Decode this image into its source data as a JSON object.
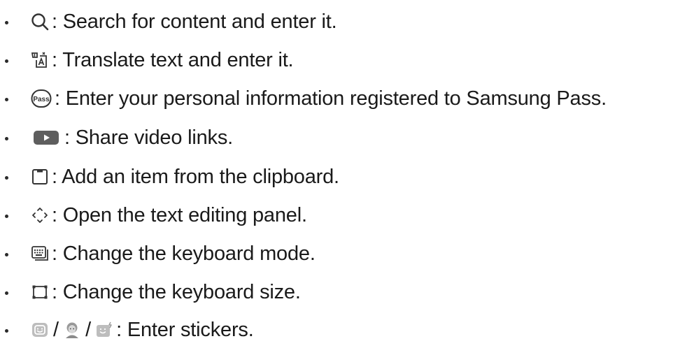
{
  "items": [
    {
      "icon": "search-icon",
      "text": ": Search for content and enter it."
    },
    {
      "icon": "translate-icon",
      "text": ": Translate text and enter it."
    },
    {
      "icon": "samsung-pass-icon",
      "icon_text": "Pass",
      "text": ": Enter your personal information registered to Samsung Pass."
    },
    {
      "icon": "video-play-icon",
      "text": ": Share video links."
    },
    {
      "icon": "clipboard-icon",
      "text": ": Add an item from the clipboard."
    },
    {
      "icon": "text-editing-icon",
      "text": ": Open the text editing panel."
    },
    {
      "icon": "keyboard-mode-icon",
      "text": ": Change the keyboard mode."
    },
    {
      "icon": "keyboard-size-icon",
      "text": ": Change the keyboard size."
    },
    {
      "icons": [
        "emoji-sticker-icon",
        "ar-emoji-icon",
        "bitmoji-icon"
      ],
      "separator": "/",
      "text": ": Enter stickers."
    }
  ],
  "colors": {
    "text": "#1a1a1a",
    "icon_stroke": "#333333",
    "video_icon_fill": "#5e5e5e",
    "sticker_icon_fill": "#bdbdbd"
  }
}
